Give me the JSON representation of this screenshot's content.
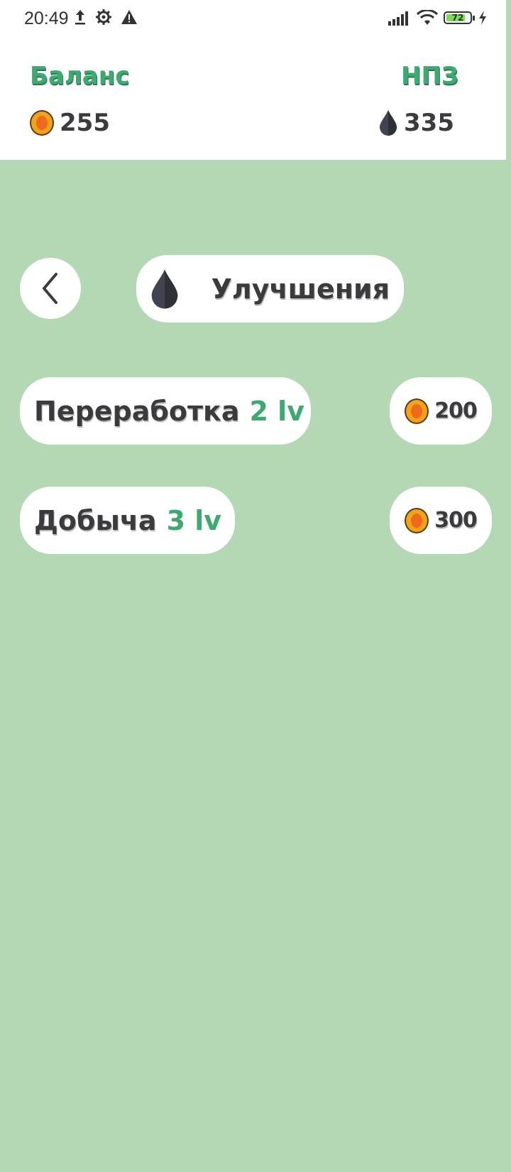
{
  "status_bar": {
    "time": "20:49",
    "battery_level": "72",
    "icons": [
      "upload-icon",
      "gear-icon",
      "warning-icon",
      "signal-icon",
      "wifi-icon",
      "battery-icon",
      "charging-icon"
    ]
  },
  "header": {
    "balance_label": "Баланс",
    "balance_value": "255",
    "refinery_label": "НПЗ",
    "refinery_value": "335"
  },
  "nav": {
    "title": "Улучшения"
  },
  "upgrades": [
    {
      "name": "Переработка",
      "level": "2 lv",
      "price": "200"
    },
    {
      "name": "Добыча",
      "level": "3 lv",
      "price": "300"
    }
  ],
  "colors": {
    "background": "#b4d8b4",
    "accent_green": "#3daa72",
    "text_dark": "#3b3b3f",
    "coin_gold": "#f2a31b",
    "oil_drop": "#41444f"
  }
}
